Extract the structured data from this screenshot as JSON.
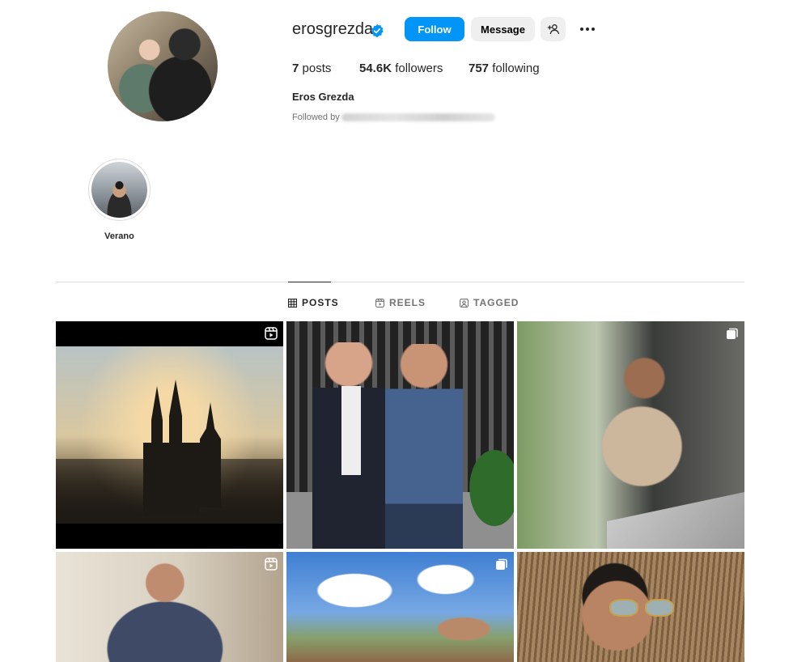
{
  "profile": {
    "username": "erosgrezda",
    "verified": true,
    "follow_label": "Follow",
    "message_label": "Message",
    "posts_count": "7",
    "posts_label": "posts",
    "followers_count": "54.6K",
    "followers_label": "followers",
    "following_count": "757",
    "following_label": "following",
    "full_name": "Eros Grezda",
    "followed_by_label": "Followed by"
  },
  "highlights": [
    {
      "label": "Verano"
    }
  ],
  "tabs": [
    {
      "label": "POSTS",
      "icon": "grid-icon",
      "active": true
    },
    {
      "label": "REELS",
      "icon": "reels-icon",
      "active": false
    },
    {
      "label": "TAGGED",
      "icon": "tagged-icon",
      "active": false
    }
  ],
  "posts": [
    {
      "type": "reel",
      "badge_icon": "reel-icon"
    },
    {
      "type": "photo",
      "badge_icon": ""
    },
    {
      "type": "carousel",
      "badge_icon": "carousel-icon"
    },
    {
      "type": "reel",
      "badge_icon": "reel-icon"
    },
    {
      "type": "carousel",
      "badge_icon": "carousel-icon"
    },
    {
      "type": "photo",
      "badge_icon": ""
    }
  ],
  "colors": {
    "accent": "#0095f6",
    "text": "#262626",
    "muted": "#737373",
    "button_bg": "#efefef",
    "divider": "#dbdbdb"
  }
}
